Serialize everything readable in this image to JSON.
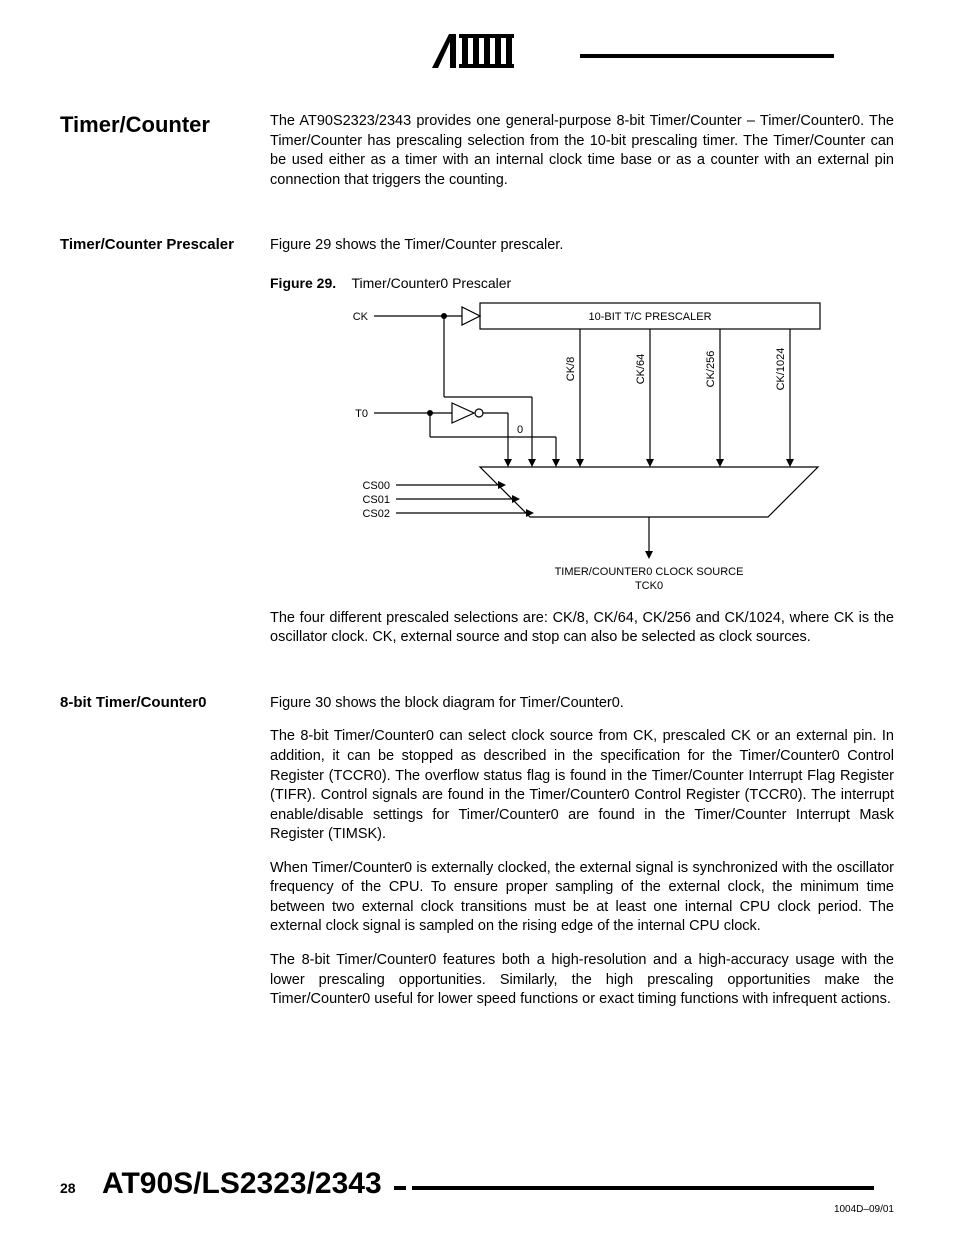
{
  "header": {
    "brand": "Atmel"
  },
  "sections": {
    "s1": {
      "title": "Timer/Counter",
      "p1": "The AT90S2323/2343 provides one general-purpose 8-bit Timer/Counter – Timer/Counter0. The Timer/Counter has prescaling selection from the 10-bit prescaling timer. The Timer/Counter can be used either as a timer with an internal clock time base or as a counter with an external pin connection that triggers the counting."
    },
    "s2": {
      "title": "Timer/Counter Prescaler",
      "p1": "Figure 29 shows the Timer/Counter prescaler.",
      "figcap_b": "Figure 29.",
      "figcap_t": "Timer/Counter0 Prescaler",
      "p2": "The four different prescaled selections are: CK/8, CK/64, CK/256 and CK/1024, where CK is the oscillator clock. CK, external source and stop can also be selected as clock sources."
    },
    "s3": {
      "title": "8-bit Timer/Counter0",
      "p1": "Figure 30 shows the block diagram for Timer/Counter0.",
      "p2": "The 8-bit Timer/Counter0 can select clock source from CK, prescaled CK or an external pin. In addition, it can be stopped as described in the specification for the Timer/Counter0 Control Register (TCCR0). The overflow status flag is found in the Timer/Counter Interrupt Flag Register (TIFR). Control signals are found in the Timer/Counter0 Control Register (TCCR0). The interrupt enable/disable settings for Timer/Counter0 are found in the Timer/Counter Interrupt Mask Register (TIMSK).",
      "p3": "When Timer/Counter0 is externally clocked, the external signal is synchronized with the oscillator frequency of the CPU. To ensure proper sampling of the external clock, the minimum time between two external clock transitions must be at least one internal CPU clock period. The external clock signal is sampled on the rising edge of the internal CPU clock.",
      "p4": "The 8-bit Timer/Counter0 features both a high-resolution and a high-accuracy usage with the lower prescaling opportunities. Similarly, the high prescaling opportunities make the Timer/Counter0 useful for lower speed functions or exact timing functions with infrequent actions."
    }
  },
  "diagram": {
    "ck": "CK",
    "t0": "T0",
    "prescaler_title": "10-BIT T/C PRESCALER",
    "taps": [
      "CK/8",
      "CK/64",
      "CK/256",
      "CK/1024"
    ],
    "zero": "0",
    "cs": [
      "CS00",
      "CS01",
      "CS02"
    ],
    "out1": "TIMER/COUNTER0 CLOCK SOURCE",
    "out2": "TCK0"
  },
  "footer": {
    "page": "28",
    "doc": "AT90S/LS2323/2343",
    "id": "1004D–09/01"
  }
}
